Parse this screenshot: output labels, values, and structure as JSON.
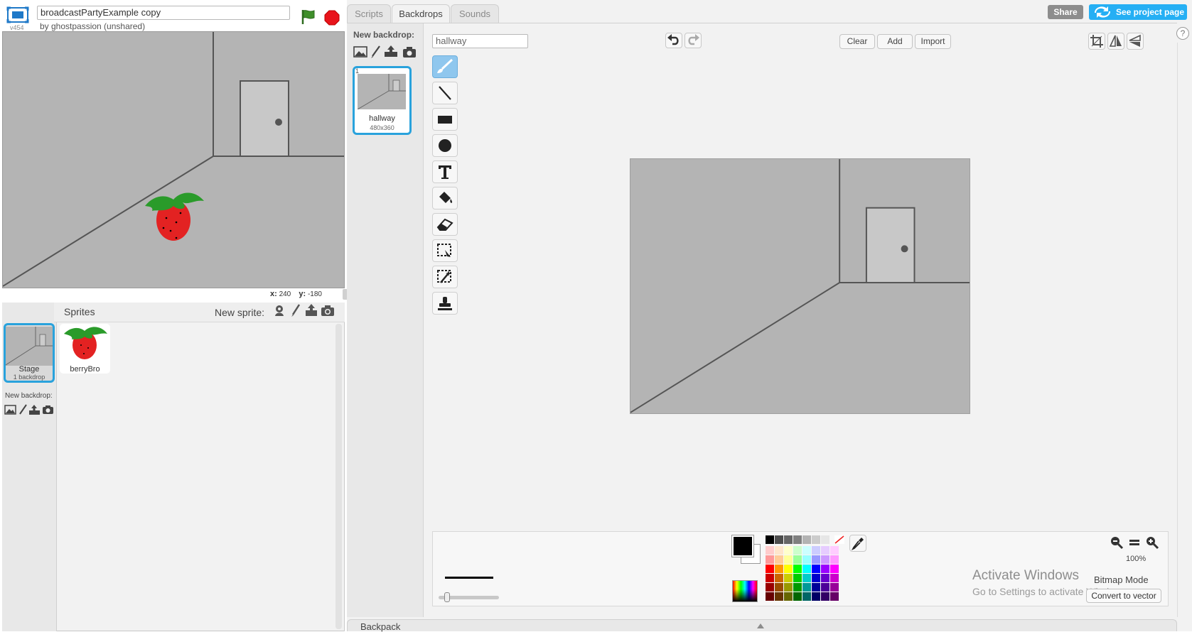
{
  "project": {
    "title": "broadcastPartyExample copy",
    "author": "by ghostpassion (unshared)",
    "version": "v454"
  },
  "stage": {
    "mouse_x_label": "x:",
    "mouse_x": "240",
    "mouse_y_label": "y:",
    "mouse_y": "-180"
  },
  "sprites_panel": {
    "title": "Sprites",
    "new_sprite_label": "New sprite:",
    "stage_item": {
      "label": "Stage",
      "sub": "1 backdrop"
    },
    "new_backdrop_label": "New backdrop:",
    "sprites": [
      {
        "name": "berryBro"
      }
    ]
  },
  "tabs": [
    {
      "label": "Scripts"
    },
    {
      "label": "Backdrops"
    },
    {
      "label": "Sounds"
    }
  ],
  "header_buttons": {
    "share": "Share",
    "see_project": "See project page"
  },
  "backdrop_list": {
    "new_backdrop_label": "New backdrop:",
    "items": [
      {
        "index": "1",
        "name": "hallway",
        "size": "480x360"
      }
    ]
  },
  "editor": {
    "costume_name": "hallway",
    "clear_label": "Clear",
    "add_label": "Add",
    "import_label": "Import",
    "help_label": "?",
    "zoom": "100%",
    "mode_label": "Bitmap Mode",
    "convert_label": "Convert to vector",
    "foreground_color": "#000000",
    "background_color": "#ffffff",
    "selected_tool": "paintbrush-icon",
    "brush_size_fraction": 0.1
  },
  "icons": {
    "tools": [
      "paintbrush-icon",
      "line-icon",
      "rectangle-icon",
      "ellipse-icon",
      "text-icon",
      "fill-bucket-icon",
      "eraser-icon",
      "select-icon",
      "select-magic-icon",
      "stamp-icon"
    ]
  },
  "palette": {
    "colors": [
      "#000000",
      "#4d4d4d",
      "#666666",
      "#808080",
      "#b3b3b3",
      "#cccccc",
      "#e6e6e6",
      "#ffffff",
      "#ffcccc",
      "#ffe6cc",
      "#ffffcc",
      "#ccffcc",
      "#ccffff",
      "#ccccff",
      "#e6ccff",
      "#ffccff",
      "#ff9999",
      "#ffcc99",
      "#ffff99",
      "#99ff99",
      "#99ffff",
      "#9999ff",
      "#cc99ff",
      "#ff99ff",
      "#ff0000",
      "#ff9900",
      "#ffff00",
      "#00ff00",
      "#00ffff",
      "#0000ff",
      "#9900ff",
      "#ff00ff",
      "#cc0000",
      "#cc6600",
      "#cccc00",
      "#00cc00",
      "#00cccc",
      "#0000cc",
      "#6600cc",
      "#cc00cc",
      "#990000",
      "#994c00",
      "#999900",
      "#009900",
      "#009999",
      "#000099",
      "#4c0099",
      "#990099",
      "#660000",
      "#663300",
      "#666600",
      "#006600",
      "#006666",
      "#000066",
      "#330066",
      "#660066"
    ]
  },
  "watermark": {
    "title": "Activate Windows",
    "subtitle": "Go to Settings to activate Windows."
  },
  "backpack": {
    "label": "Backpack"
  }
}
